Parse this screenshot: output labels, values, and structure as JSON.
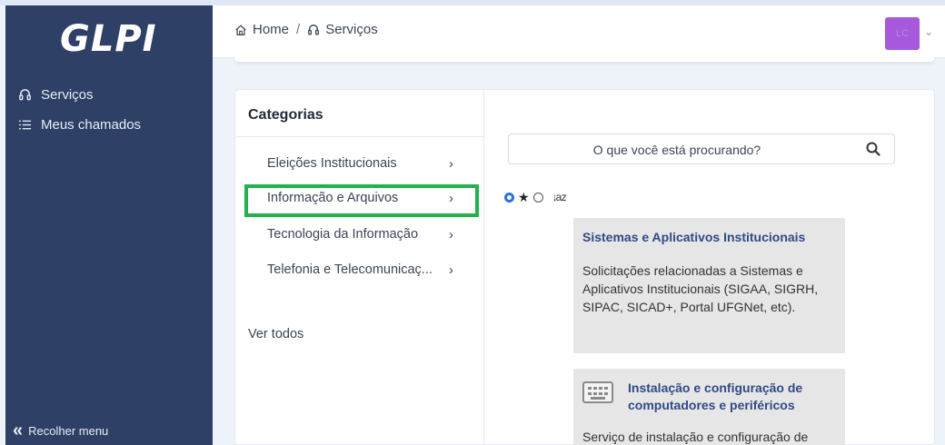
{
  "sidebar": {
    "logo": "GLPI",
    "items": [
      {
        "label": "Serviços",
        "icon": "headset-icon"
      },
      {
        "label": "Meus chamados",
        "icon": "list-icon"
      }
    ],
    "collapse_label": "Recolher menu",
    "collapse_icon": "double-chevron-left-icon"
  },
  "header": {
    "breadcrumb": [
      {
        "label": "Home",
        "icon": "home-icon"
      },
      {
        "label": "Serviços",
        "icon": "headset-icon"
      }
    ],
    "separator": "/",
    "avatar_initials": "LC",
    "avatar_color": "#a659dc"
  },
  "categories": {
    "title": "Categorias",
    "items": [
      {
        "label": "Eleições Institucionais",
        "selected": false
      },
      {
        "label": "Informação e Arquivos",
        "selected": true
      },
      {
        "label": "Tecnologia da Informação",
        "selected": false
      },
      {
        "label": "Telefonia e Telecomunicaç...",
        "selected": false
      }
    ],
    "see_all": "Ver todos",
    "highlight_color": "#22b14c"
  },
  "search": {
    "placeholder": "O que você está procurando?"
  },
  "sort": {
    "options": [
      "popularity",
      "alphabetical"
    ],
    "selected": "popularity"
  },
  "services": [
    {
      "title": "Sistemas e Aplicativos Institucionais",
      "description": "Solicitações relacionadas a Sistemas e Aplicativos Institucionais (SIGAA, SIGRH, SIPAC, SICAD+, Portal UFGNet, etc).",
      "icon": null
    },
    {
      "title": "Instalação e configuração de computadores e periféricos",
      "description": "Serviço de instalação e configuração de",
      "icon": "keyboard-icon"
    }
  ]
}
